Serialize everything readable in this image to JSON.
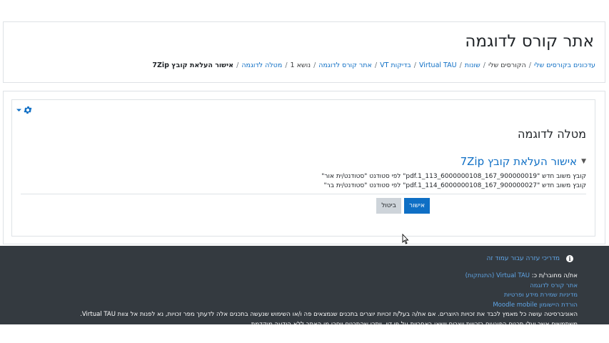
{
  "header": {
    "course_title": "אתר קורס לדוגמה",
    "breadcrumb": [
      {
        "label": "עדכונים בקורסים שלי",
        "link": true
      },
      {
        "label": "הקורסים שלי",
        "link": false
      },
      {
        "label": "שונות",
        "link": true
      },
      {
        "label": "Virtual TAU",
        "link": true
      },
      {
        "label": "בדיקות VT",
        "link": true
      },
      {
        "label": "אתר קורס לדוגמה",
        "link": true
      },
      {
        "label": "נושא 1",
        "link": false
      },
      {
        "label": "מטלה לדוגמה",
        "link": true
      },
      {
        "label": "אישור העלאת קובץ 7Zip",
        "link": false
      }
    ]
  },
  "main": {
    "module_title": "מטלה לדוגמה",
    "section_title": "אישור העלאת קובץ 7Zip",
    "files": [
      "קובץ משוב חדש \"pdf.1_113_6000000108_167_900000019\" לפי סטודנט \"סטודנט/ית אור\"",
      "קובץ משוב חדש \"pdf.1_114_6000000108_167_900000027\" לפי סטודנט \"סטודנט/ית בר\""
    ],
    "cancel_label": "ביטול",
    "confirm_label": "אישור"
  },
  "footer": {
    "help_link": "מדריכי עזרה עבור עמוד זה",
    "logged_in_prefix": "את/ה מחובר/ת כ: ",
    "logged_in_user": "Virtual TAU",
    "logout_label": "(התנתקות)",
    "course_link": "אתר קורס לדוגמה",
    "privacy_link": "מדיניות שמירת מידע ופרטיות",
    "mobile_link": "הורדת היישומון Moodle mobile",
    "disclaimer": "האוניברסיטה עושה כל מאמץ לכבד את זכויות היוצרים. אם את/ה בעל/ת זכויות יוצרים בתכנים שנמצאים פה ו/או השימוש שנעשה בתכנים אלה לדעתך מפר זכויות, נא לפנות אל צוות Virtual TAU.",
    "cut_line": "משתמשים אשר יעלו תכנים הפוגעים בזכויות יוצרים יישאו באחריות על פי דין. ייתכן שהתכנים יוסרו מן האתר ללא הודעה מוקדמת."
  },
  "colors": {
    "link": "#0f6fc5",
    "primary_button": "#0f6fc5",
    "footer_bg": "#343a40"
  }
}
